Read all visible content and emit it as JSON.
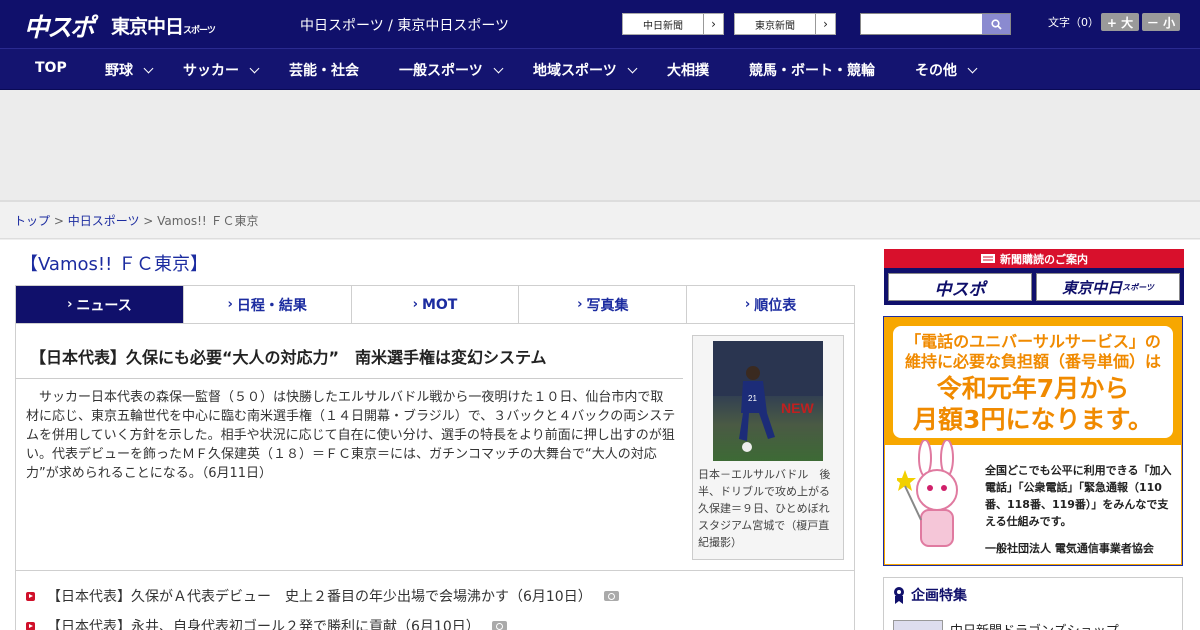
{
  "header": {
    "logo_chuspo": "中スポ",
    "logo_tokyo": "東京中日",
    "logo_tokyo_sub": "スポーツ",
    "site_title": "中日スポーツ / 東京中日スポーツ",
    "link1": "中日新聞",
    "link2": "東京新聞",
    "search_placeholder": "",
    "font_size_label": "文字（0）",
    "font_bigger": "+ 大",
    "font_smaller": "－ 小"
  },
  "nav": [
    "TOP",
    "野球",
    "サッカー",
    "芸能・社会",
    "一般スポーツ",
    "地域スポーツ",
    "大相撲",
    "競馬・ボート・競輪",
    "その他"
  ],
  "breadcrumb": {
    "home": "トップ",
    "sep": " > ",
    "section": "中日スポーツ",
    "current": "Vamos!! ＦＣ東京"
  },
  "page_title": "【Vamos!! ＦＣ東京】",
  "tabs": [
    "ニュース",
    "日程・結果",
    "MOT",
    "写真集",
    "順位表"
  ],
  "article": {
    "heading": "【日本代表】久保にも必要“大人の対応力”　南米選手権は変幻システム",
    "body": "サッカー日本代表の森保一監督（５０）は快勝したエルサルバドル戦から一夜明けた１０日、仙台市内で取材に応じ、東京五輪世代を中心に臨む南米選手権（１４日開幕・ブラジル）で、３バックと４バックの両システムを併用していく方針を示した。相手や状況に応じて自在に使い分け、選手の特長をより前面に押し出すのが狙い。代表デビューを飾ったＭＦ久保建英（１８）＝ＦＣ東京＝には、ガチンコマッチの大舞台で“大人の対応力”が求められることになる。（6月11日）",
    "caption": "日本－エルサルバドル　後半、ドリブルで攻め上がる久保建＝９日、ひとめぼれスタジアム宮城で（榎戸直紀撮影）",
    "photo_jersey": "21",
    "photo_banner": "NEW"
  },
  "related": [
    "【日本代表】久保がＡ代表デビュー　史上２番目の年少出場で会場沸かす（6月10日）",
    "【日本代表】永井、自身代表初ゴール２発で勝利に貢献（6月10日）"
  ],
  "sidebar": {
    "subscription_head": "新聞購読のご案内",
    "sub_btn1": "中スポ",
    "sub_btn2": "東京中日",
    "sub_btn2_small": "スポーツ",
    "ad_line1": "「電話のユニバーサルサービス」の",
    "ad_line2": "維持に必要な負担額（番号単価）は",
    "ad_line3": "令和元年7月から",
    "ad_line4": "月額3円になります。",
    "ad_info": "全国どこでも公平に利用できる「加入電話」「公衆電話」「緊急通報（110番、118番、119番）」をみんなで支える仕組みです。",
    "ad_org": "一般社団法人 電気通信事業者協会",
    "special_head": "企画特集",
    "special_item": "中日新聞ドラゴンズショップ"
  },
  "colors": {
    "navy": "#10106b",
    "link": "#1c2ca0",
    "red": "#d8102c",
    "orange": "#f7a700"
  }
}
